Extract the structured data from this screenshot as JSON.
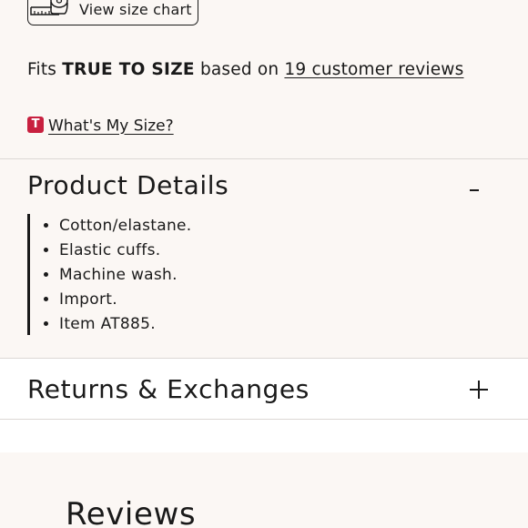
{
  "size_chart": {
    "label": "View size chart",
    "icon": "measuring-tape-icon"
  },
  "fit": {
    "prefix": "Fits",
    "emphasis": "TRUE TO SIZE",
    "middle": "based on",
    "reviews_link": "19 customer reviews"
  },
  "whats_my_size": {
    "badge": "T",
    "badge_color": "#c8203f",
    "label": "What's My Size?"
  },
  "product_details": {
    "title": "Product Details",
    "toggle": "minus-icon",
    "items": [
      "Cotton/elastane.",
      "Elastic cuffs.",
      "Machine wash.",
      "Import.",
      "Item AT885."
    ]
  },
  "returns": {
    "title": "Returns & Exchanges",
    "toggle": "plus-icon"
  },
  "reviews": {
    "title": "Reviews"
  },
  "colors": {
    "section_bg": "#fbf7f4",
    "text": "#1a1a1a",
    "divider": "#dcd8d5"
  }
}
